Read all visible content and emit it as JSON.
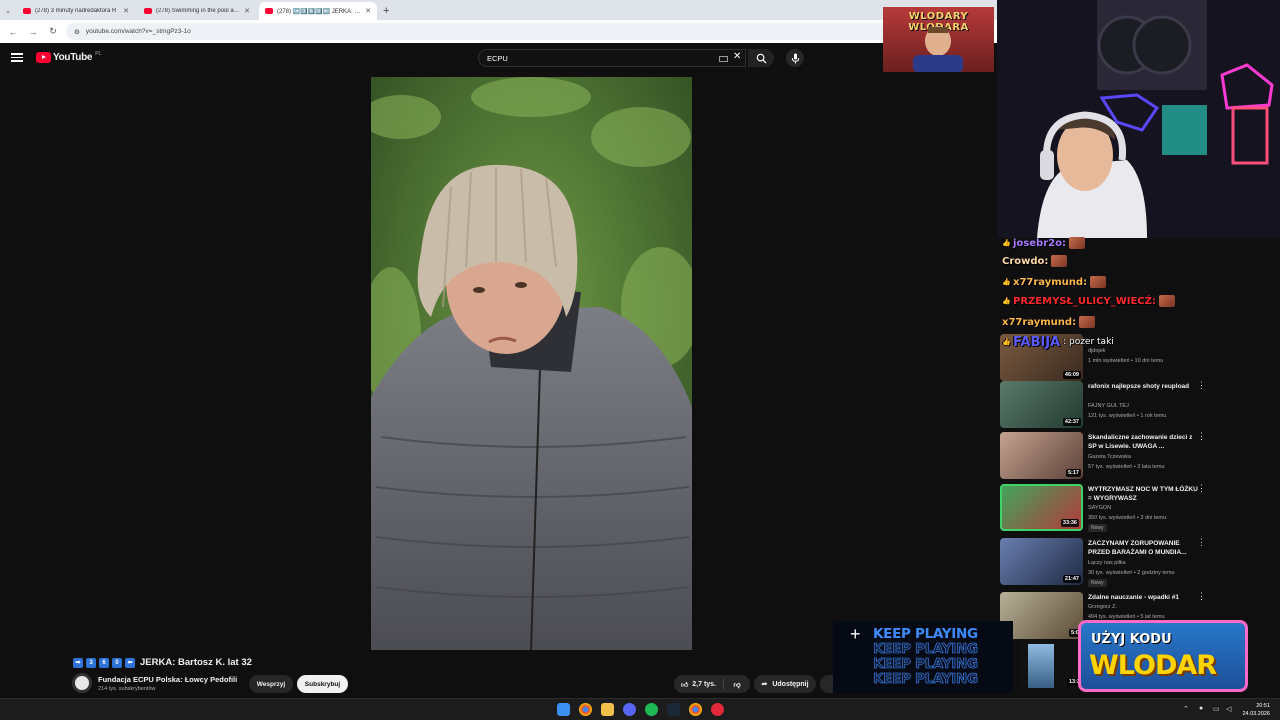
{
  "browser": {
    "tabs": [
      {
        "title": "(278) 3 minuty nadredaktora R",
        "active": false
      },
      {
        "title": "(278) Swimming in the pool afte",
        "active": false
      },
      {
        "title": "(278) ➡️3️⃣6️⃣0️⃣⬅️ JERKA: Barto",
        "active": true
      }
    ],
    "url": "youtube.com/watch?v=_stmgPz3-1o"
  },
  "youtube": {
    "logo_text": "YouTube",
    "country": "PL",
    "search_value": "ECPU"
  },
  "video": {
    "title_keys": [
      "➡",
      "3",
      "6",
      "0",
      "⬅"
    ],
    "title_text": "JERKA: Bartosz K. lat 32",
    "channel_name": "Fundacja ECPU Polska: Łowcy Pedofili",
    "channel_subs": "214 tys. subskrybentów",
    "support_label": "Wesprzyj",
    "subscribe_label": "Subskrybuj",
    "likes": "2,7 tys.",
    "share_label": "Udostępnij"
  },
  "overlay": {
    "banner_line1": "WLODARY",
    "banner_line2": "WLODARA"
  },
  "chat": [
    {
      "user": "josebr2o:",
      "color": "#a97cff",
      "message": "",
      "icon": "👍"
    },
    {
      "user": "Crowdo:",
      "color": "#ffd9a8",
      "message": "",
      "icon": ""
    },
    {
      "user": "x77raymund:",
      "color": "#ffb84d",
      "message": "",
      "icon": "👍"
    },
    {
      "user": "PRZEMYSŁ_ULICY_WIECŹ:",
      "color": "#ff2b2b",
      "message": "",
      "icon": "👍"
    },
    {
      "user": "x77raymund:",
      "color": "#ffb84d",
      "message": "",
      "icon": ""
    },
    {
      "user": "FABIJA",
      "color": "#5b5bff",
      "message": ": pozer taki",
      "icon": "👍"
    }
  ],
  "recommendations": [
    {
      "title": "",
      "channel": "djdojek",
      "meta": "1 mln wyświetleń • 10 dni temu",
      "duration": "46:09",
      "badge": ""
    },
    {
      "title": "rafonix najlepsze shoty reupload",
      "channel": "FAJNY GUL TEJ",
      "meta": "121 tys. wyświetleń • 1 rok temu",
      "duration": "42:37",
      "badge": ""
    },
    {
      "title": "Skandaliczne zachowanie dzieci z SP w Lisewie. UWAGA ...",
      "channel": "Gazeta Tczewska",
      "meta": "57 tys. wyświetleń • 3 lata temu",
      "duration": "5:17",
      "badge": ""
    },
    {
      "title": "WYTRZYMASZ NOC W TYM ŁÓŻKU = WYGRYWASZ",
      "channel": "SAYGON",
      "meta": "350 tys. wyświetleń • 3 dni temu",
      "duration": "33:36",
      "badge": "Nowy"
    },
    {
      "title": "ZACZYNAMY ZGRUPOWANIE PRZED BARAŻAMI O MUNDIA...",
      "channel": "Łączy nas piłka",
      "meta": "30 tys. wyświetleń • 2 godziny temu",
      "duration": "21:47",
      "badge": "Nowy"
    },
    {
      "title": "Zdalne nauczanie - wpadki #1",
      "channel": "Grzegorz Z.",
      "meta": "494 tys. wyświetleń • 5 lat temu",
      "duration": "5:0",
      "badge": ""
    }
  ],
  "promo": {
    "keep_playing": "KEEP PLAYING",
    "code_line1": "UŻYJ KODU",
    "code_line2": "WLODAR",
    "card_duration": "13:3"
  },
  "taskbar": {
    "time": "20:51",
    "date": "24.03.2026"
  },
  "colors": {
    "yt_red": "#ff0033",
    "yt_bg": "#0f0f0f",
    "promo_yellow": "#ffd400",
    "keep_playing_blue": "#3d8bff"
  }
}
